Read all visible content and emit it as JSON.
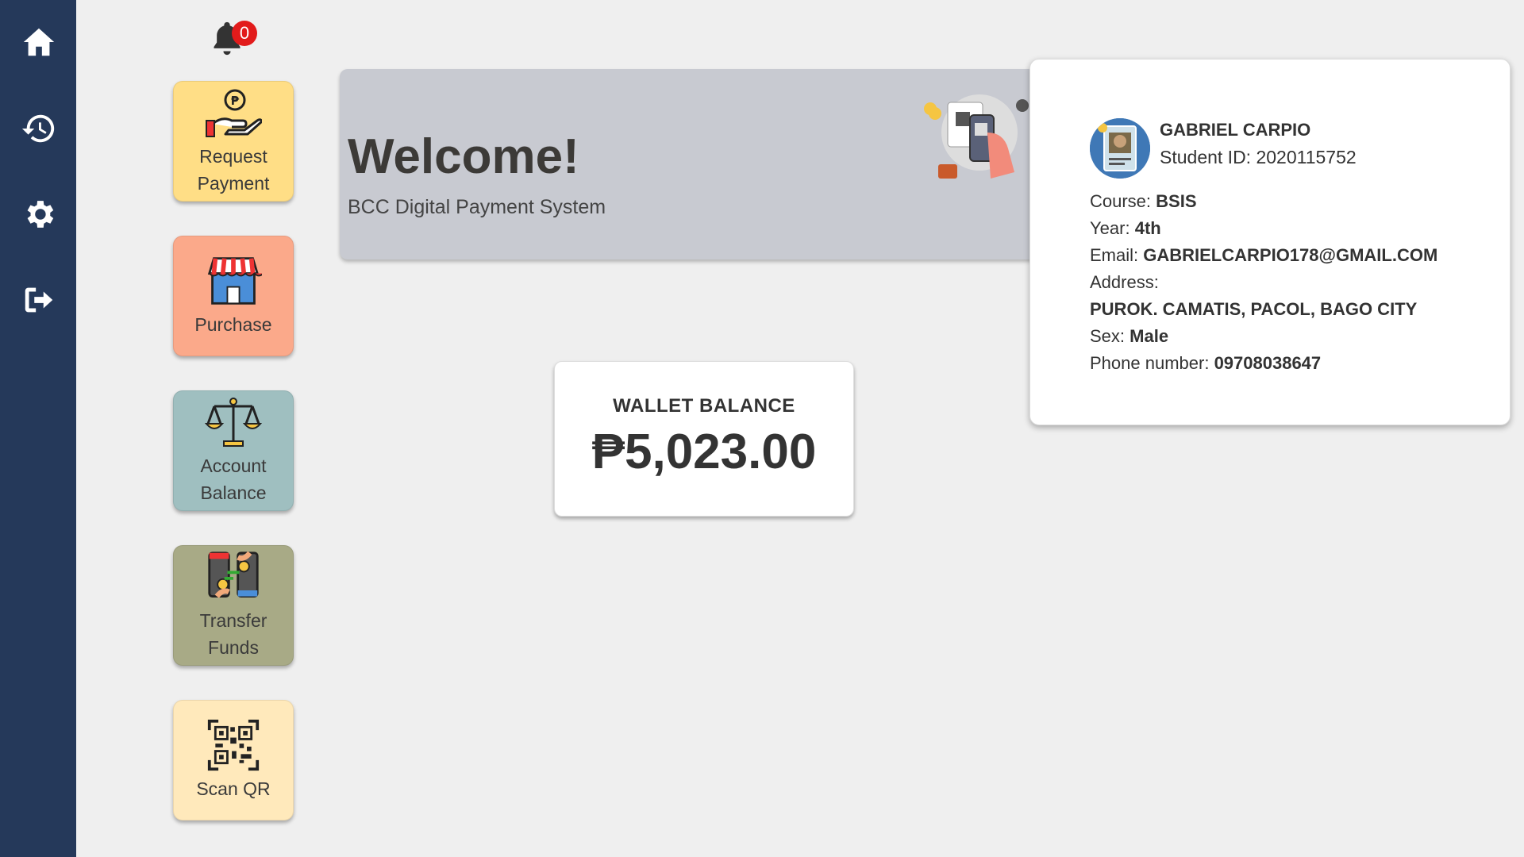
{
  "sidebar": {
    "items": [
      {
        "name": "home-icon"
      },
      {
        "name": "history-icon"
      },
      {
        "name": "gear-icon"
      },
      {
        "name": "logout-icon"
      }
    ]
  },
  "notifications": {
    "count": "0"
  },
  "tiles": [
    {
      "label": "Request\nPayment",
      "color": "#ffde86",
      "icon": "hand-coin-icon"
    },
    {
      "label": "Purchase",
      "color": "#fba98a",
      "icon": "store-icon"
    },
    {
      "label": "Account\nBalance",
      "color": "#9fbfc0",
      "icon": "scale-icon"
    },
    {
      "label": "Transfer\nFunds",
      "color": "#a8aa86",
      "icon": "transfer-icon"
    },
    {
      "label": "Scan QR",
      "color": "#ffe9bb",
      "icon": "qr-code-icon"
    }
  ],
  "banner": {
    "title": "Welcome!",
    "subtitle": "BCC Digital Payment System"
  },
  "wallet": {
    "label": "WALLET BALANCE",
    "amount": "₱5,023.00"
  },
  "profile": {
    "name": "GABRIEL CARPIO",
    "student_id_label": "Student ID:",
    "student_id": "2020115752",
    "course_label": "Course:",
    "course": "BSIS",
    "year_label": "Year:",
    "year": "4th",
    "email_label": "Email:",
    "email": "GABRIELCARPIO178@GMAIL.COM",
    "address_label": "Address:",
    "address": "PUROK. CAMATIS, PACOL, BAGO CITY",
    "sex_label": "Sex:",
    "sex": "Male",
    "phone_label": "Phone number:",
    "phone": "09708038647"
  },
  "colors": {
    "sidebar": "#25395a",
    "background": "#efefef",
    "badge": "#e21b1b",
    "banner": "#c8cad1"
  }
}
